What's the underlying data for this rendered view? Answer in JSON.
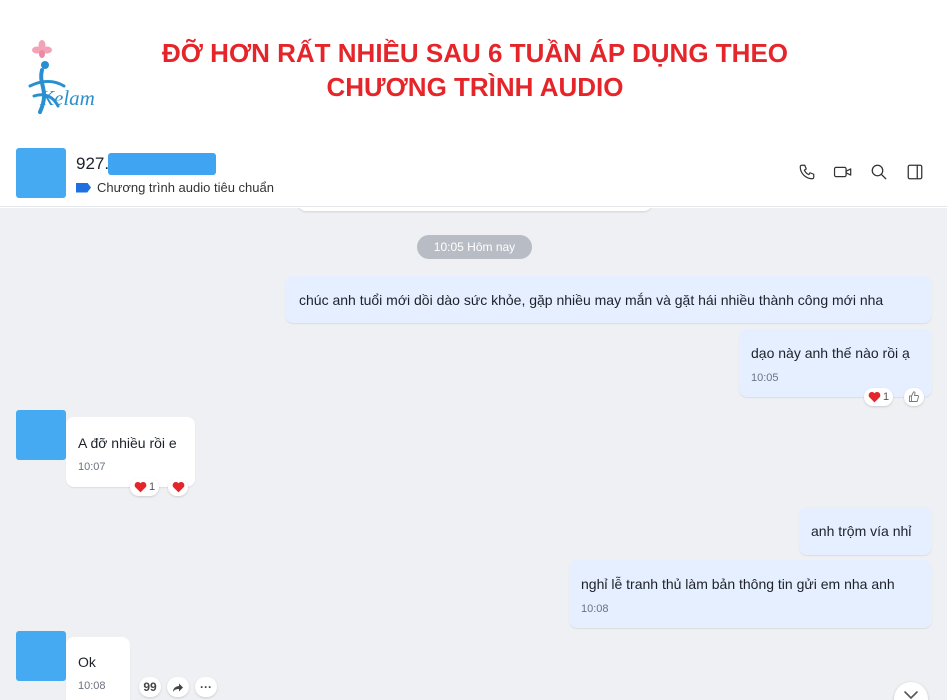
{
  "banner": {
    "logo_text": "Kelam",
    "headline_line1": "ĐỠ HƠN RẤT NHIỀU SAU 6 TUẦN ÁP DỤNG THEO",
    "headline_line2": "CHƯƠNG TRÌNH AUDIO"
  },
  "header": {
    "contact_name": "927.",
    "tag_label": "Chương trình audio tiêu chuẩn",
    "icons": [
      "phone-icon",
      "video-icon",
      "search-icon",
      "sidebar-toggle-icon"
    ]
  },
  "colors": {
    "headline": "#e5252a",
    "avatar": "#45aaf2",
    "outgoing_bubble": "#e5efff",
    "incoming_bubble": "#ffffff",
    "chat_background": "#eef0f3",
    "tag": "#1e6fe0"
  },
  "chat": {
    "time_separator": "10:05 Hôm nay",
    "messages": [
      {
        "direction": "out",
        "text": "chúc anh tuổi mới dồi dào sức khỏe, gặp nhiều may mắn và gặt hái nhiều thành công mới nha"
      },
      {
        "direction": "out",
        "text": "dạo này anh thế nào rồi ạ",
        "time": "10:05",
        "reaction_count": "1"
      },
      {
        "direction": "in",
        "text": "A đỡ nhiều rồi e",
        "time": "10:07",
        "reaction_count": "1"
      },
      {
        "direction": "out",
        "text": "anh trộm vía nhỉ"
      },
      {
        "direction": "out",
        "text": "nghỉ lễ tranh thủ làm bản thông tin gửi em nha anh",
        "time": "10:08"
      },
      {
        "direction": "in",
        "text": "Ok",
        "time": "10:08"
      }
    ],
    "message_actions": {
      "quote": "99",
      "more": "···"
    }
  }
}
